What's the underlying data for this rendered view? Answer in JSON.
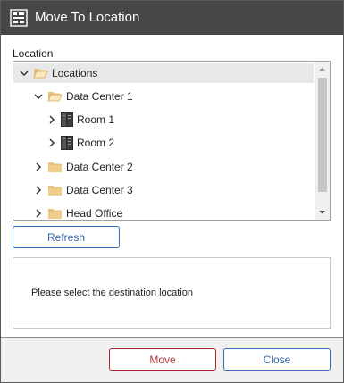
{
  "window": {
    "title": "Move To Location"
  },
  "location_label": "Location",
  "tree": {
    "items": [
      {
        "label": "Locations",
        "icon": "folder-open-icon",
        "state": "expanded"
      },
      {
        "label": "Data Center 1",
        "icon": "folder-open-icon",
        "state": "expanded"
      },
      {
        "label": "Room 1",
        "icon": "server-rack-icon",
        "state": "collapsed"
      },
      {
        "label": "Room 2",
        "icon": "server-rack-icon",
        "state": "collapsed"
      },
      {
        "label": "Data Center 2",
        "icon": "folder-icon",
        "state": "collapsed"
      },
      {
        "label": "Data Center 3",
        "icon": "folder-icon",
        "state": "collapsed"
      },
      {
        "label": "Head Office",
        "icon": "folder-icon",
        "state": "collapsed"
      }
    ]
  },
  "buttons": {
    "refresh": "Refresh",
    "move": "Move",
    "close": "Close"
  },
  "message": "Please select the destination location",
  "colors": {
    "titlebar": "#474747",
    "folder": "#e8c07a",
    "move_border": "#a62c2c",
    "close_border": "#2e6fb8"
  }
}
